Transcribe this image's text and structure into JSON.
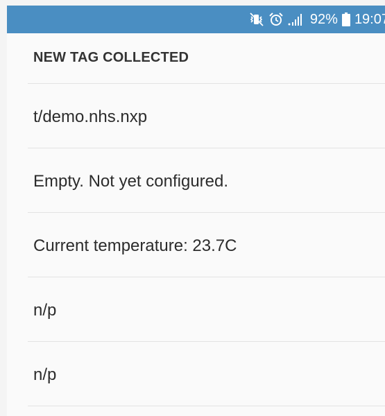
{
  "status_bar": {
    "signal_text": ".ıl",
    "battery_percent": "92%",
    "time": "19:07",
    "background_color": "#4a8ec2",
    "icons": [
      "mute-vibrate-icon",
      "alarm-icon",
      "signal-icon",
      "battery-icon"
    ]
  },
  "list": {
    "header": "NEW TAG COLLECTED",
    "rows": [
      "t/demo.nhs.nxp",
      "Empty. Not yet configured.",
      "Current temperature:  23.7C",
      "n/p",
      "n/p"
    ]
  }
}
